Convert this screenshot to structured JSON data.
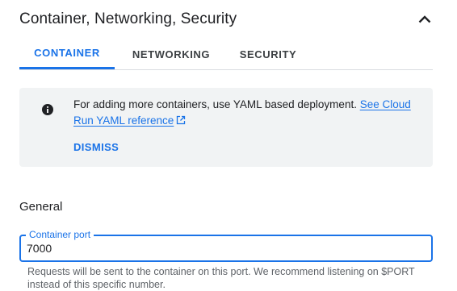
{
  "panel": {
    "title": "Container, Networking, Security",
    "collapse_icon": "chevron-up-icon"
  },
  "tabs": [
    {
      "label": "CONTAINER",
      "active": true
    },
    {
      "label": "NETWORKING",
      "active": false
    },
    {
      "label": "SECURITY",
      "active": false
    }
  ],
  "info": {
    "icon": "info-icon",
    "text": "For adding more containers, use YAML based deployment. ",
    "link": "See Cloud Run YAML reference",
    "link_icon": "open-in-new-icon",
    "dismiss_label": "DISMISS"
  },
  "general": {
    "title": "General",
    "port_label": "Container port",
    "port_value": "7000",
    "helper": "Requests will be sent to the container on this port. We recommend listening on $PORT instead of this specific number."
  },
  "colors": {
    "accent": "#1a73e8",
    "info_bg": "#f1f3f4",
    "text": "#202124",
    "muted": "#5f6368"
  }
}
